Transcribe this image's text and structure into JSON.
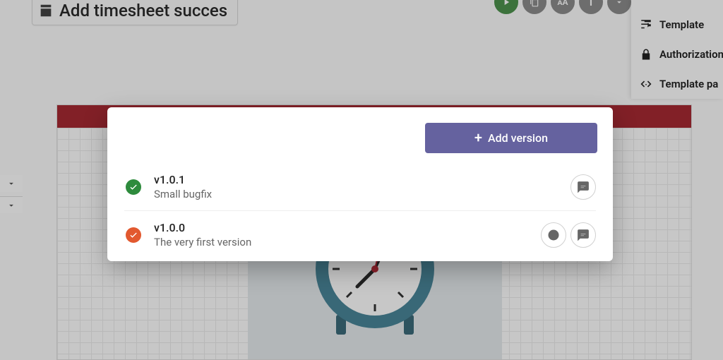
{
  "header": {
    "title": "Add timesheet succes"
  },
  "side_menu": {
    "template_label": "Template",
    "authorization_label": "Authorization",
    "template_params_label": "Template pa"
  },
  "modal": {
    "add_button_label": "Add version",
    "versions": [
      {
        "name": "v1.0.1",
        "description": "Small bugfix",
        "status_color": "green",
        "show_approve_action": false
      },
      {
        "name": "v1.0.0",
        "description": "The very first version",
        "status_color": "orange",
        "show_approve_action": true
      }
    ]
  },
  "icons": {
    "title_chip": "form-icon",
    "toolbar": [
      "play-icon",
      "copy-icon",
      "translate-icon",
      "info-icon",
      "chevron-down-icon"
    ],
    "side_menu": [
      "sliders-icon",
      "lock-icon",
      "code-icon"
    ]
  }
}
